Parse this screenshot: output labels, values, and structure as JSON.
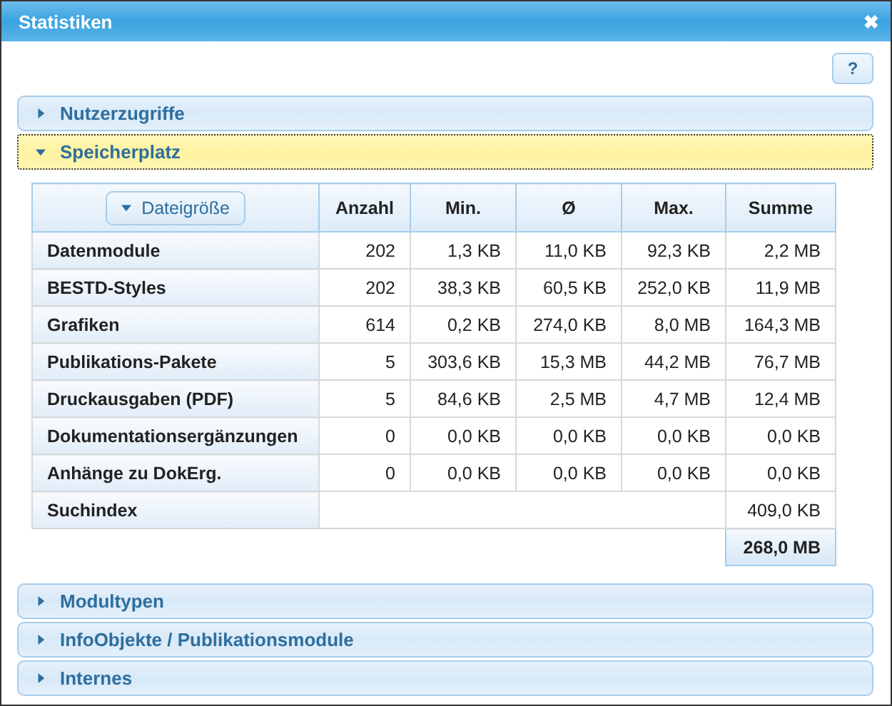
{
  "window": {
    "title": "Statistiken",
    "close": "✖"
  },
  "help_button": "?",
  "sections": [
    {
      "title": "Nutzerzugriffe",
      "expanded": false
    },
    {
      "title": "Speicherplatz",
      "expanded": true,
      "table": {
        "group_button": "Dateigröße",
        "columns": [
          "Anzahl",
          "Min.",
          "Ø",
          "Max.",
          "Summe"
        ],
        "rows": [
          {
            "label": "Datenmodule",
            "cells": [
              "202",
              "1,3 KB",
              "11,0 KB",
              "92,3 KB",
              "2,2 MB"
            ]
          },
          {
            "label": "BESTD-Styles",
            "cells": [
              "202",
              "38,3 KB",
              "60,5 KB",
              "252,0 KB",
              "11,9 MB"
            ]
          },
          {
            "label": "Grafiken",
            "cells": [
              "614",
              "0,2 KB",
              "274,0 KB",
              "8,0 MB",
              "164,3 MB"
            ]
          },
          {
            "label": "Publikations-Pakete",
            "cells": [
              "5",
              "303,6 KB",
              "15,3 MB",
              "44,2 MB",
              "76,7 MB"
            ]
          },
          {
            "label": "Druckausgaben (PDF)",
            "cells": [
              "5",
              "84,6 KB",
              "2,5 MB",
              "4,7 MB",
              "12,4 MB"
            ]
          },
          {
            "label": "Dokumentationsergänzungen",
            "cells": [
              "0",
              "0,0 KB",
              "0,0 KB",
              "0,0 KB",
              "0,0 KB"
            ]
          },
          {
            "label": "Anhänge zu DokErg.",
            "cells": [
              "0",
              "0,0 KB",
              "0,0 KB",
              "0,0 KB",
              "0,0 KB"
            ]
          }
        ],
        "index_row": {
          "label": "Suchindex",
          "sum": "409,0 KB"
        },
        "total": "268,0 MB"
      }
    },
    {
      "title": "Modultypen",
      "expanded": false
    },
    {
      "title": "InfoObjekte / Publikationsmodule",
      "expanded": false
    },
    {
      "title": "Internes",
      "expanded": false
    }
  ]
}
